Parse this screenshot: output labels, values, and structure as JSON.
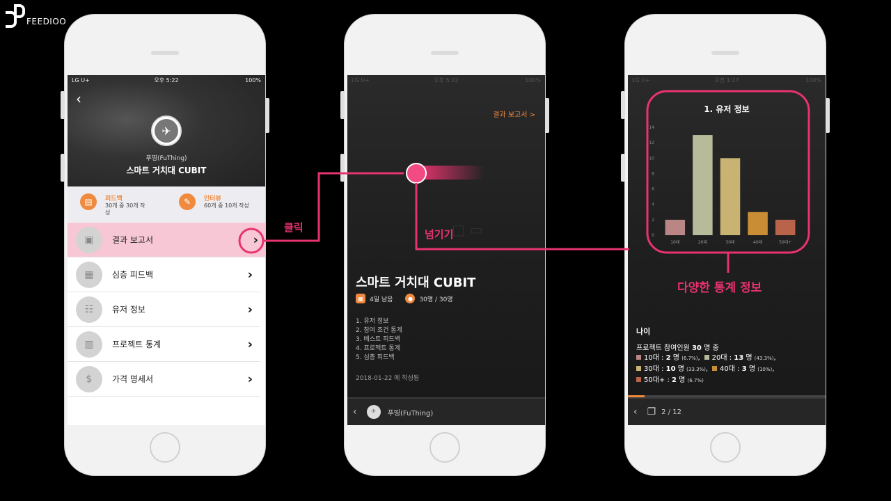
{
  "brand": {
    "logo_text": "FEEDIOO"
  },
  "status_left": "LG U+",
  "status_battery": "100%",
  "phone1": {
    "time": "오후 5:22",
    "org": "푸띵(FuThing)",
    "title": "스마트 거치대 CUBIT",
    "stats": [
      {
        "icon": "clipboard-icon",
        "label": "피드백",
        "value": "30개 중 30개 작성"
      },
      {
        "icon": "microphone-icon",
        "label": "인터뷰",
        "value": "60개 중 10개 작성"
      }
    ],
    "menu": [
      {
        "icon": "report-icon",
        "label": "결과 보고서"
      },
      {
        "icon": "feedback-icon",
        "label": "심층 피드백"
      },
      {
        "icon": "users-icon",
        "label": "유저 정보"
      },
      {
        "icon": "bar-chart-icon",
        "label": "프로젝트 통계"
      },
      {
        "icon": "price-tag-icon",
        "label": "가격 명세서"
      }
    ]
  },
  "phone2": {
    "time": "오후 5:22",
    "report_link": "결과 보고서 >",
    "title": "스마트 거치대 CUBIT",
    "days_left": "4일 남음",
    "participants": "30명 / 30명",
    "toc": [
      "1. 유저 정보",
      "2. 참여 조건 통계",
      "3. 베스트 피드백",
      "4. 프로젝트 통계",
      "5. 심층 피드백"
    ],
    "date": "2018-01-22 에 작성됨",
    "footer_org": "푸띵(FuThing)"
  },
  "phone3": {
    "time": "오전 1:27",
    "age_title": "나이",
    "summary_prefix": "프로젝트 참여인원 ",
    "summary_count": "30",
    "summary_suffix": " 명 중",
    "legend": [
      {
        "label": "10대 : ",
        "count": "2",
        "unit": " 명 ",
        "pct": "(6.7%)",
        "sep": ",",
        "color": "#b98585"
      },
      {
        "label": "20대 : ",
        "count": "13",
        "unit": " 명 ",
        "pct": "(43.3%)",
        "sep": ",",
        "color": "#b8bb9a"
      },
      {
        "label": "30대 : ",
        "count": "10",
        "unit": " 명 ",
        "pct": "(33.3%)",
        "sep": ",",
        "color": "#c9b372"
      },
      {
        "label": "40대 : ",
        "count": "3",
        "unit": " 명 ",
        "pct": "(10%)",
        "sep": ",",
        "color": "#c98d35"
      },
      {
        "label": "50대+ : ",
        "count": "2",
        "unit": " 명 ",
        "pct": "(6.7%)",
        "sep": "",
        "color": "#b9644a"
      }
    ],
    "page": "2 / 12",
    "progress": 0.083
  },
  "annotations": {
    "click": "클릭",
    "swipe": "넘기기",
    "stats": "다양한 통계 정보"
  },
  "chart_data": {
    "type": "bar",
    "title": "1. 유저 정보",
    "categories": [
      "10대",
      "20대",
      "30대",
      "40대",
      "50대+"
    ],
    "values": [
      2,
      13,
      10,
      3,
      2
    ],
    "colors": [
      "#b98585",
      "#b8bb9a",
      "#c9b372",
      "#c98d35",
      "#b9644a"
    ],
    "yticks": [
      0,
      2,
      4,
      6,
      8,
      10,
      12,
      14
    ],
    "ylim": [
      0,
      14
    ],
    "xlabel": "",
    "ylabel": ""
  }
}
